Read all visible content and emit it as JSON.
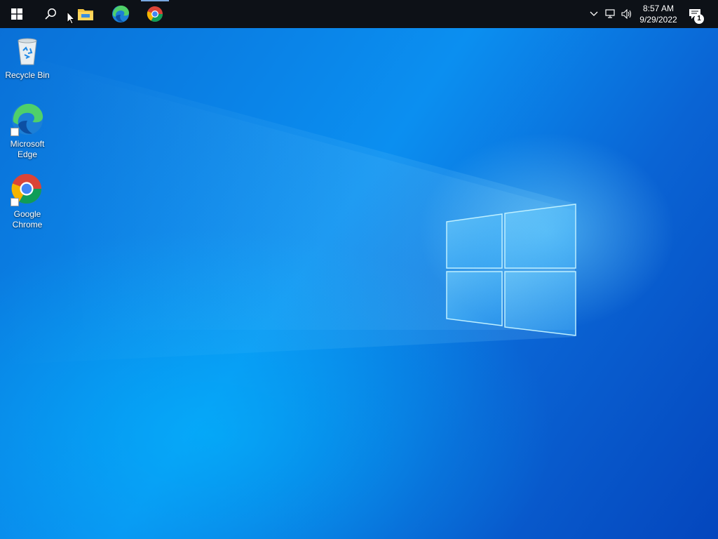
{
  "taskbar": {
    "start_icon": "windows-logo-icon",
    "search_icon": "search-icon",
    "pinned": [
      {
        "name": "File Explorer",
        "icon": "folder-icon"
      },
      {
        "name": "Microsoft Edge",
        "icon": "edge-icon"
      },
      {
        "name": "Google Chrome",
        "icon": "chrome-icon",
        "active": true
      }
    ],
    "tray": {
      "chevron_icon": "chevron-up-icon",
      "network_icon": "network-icon",
      "volume_icon": "volume-icon",
      "time": "8:57 AM",
      "date": "9/29/2022",
      "notifications_icon": "notification-icon",
      "notification_count": "1"
    }
  },
  "desktop_icons": [
    {
      "label": "Recycle Bin",
      "icon": "recycle-bin-icon"
    },
    {
      "label": "Microsoft Edge",
      "icon": "edge-icon"
    },
    {
      "label": "Google Chrome",
      "icon": "chrome-icon"
    }
  ],
  "colors": {
    "taskbar": "#0d1117",
    "wallpaper_light": "#0b8ff0",
    "wallpaper_dark": "#0446bd"
  }
}
